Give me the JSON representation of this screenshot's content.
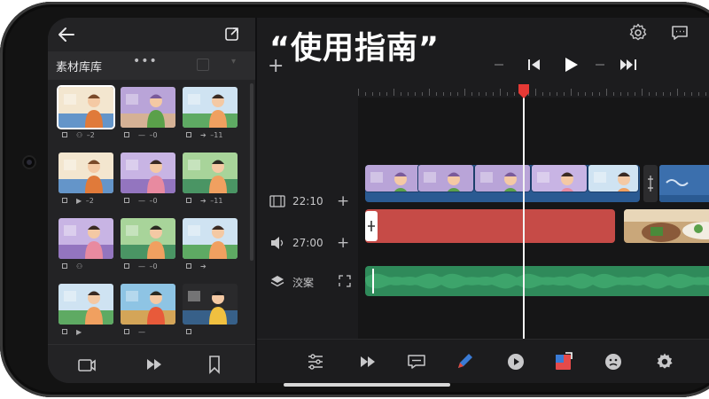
{
  "app": {
    "title": "“使用指南”"
  },
  "library": {
    "title": "素材库库",
    "more": "•••",
    "clips": [
      {
        "meta_icon": "person-icon",
        "meta": "2",
        "selected": true,
        "scene": "person-table"
      },
      {
        "meta_icon": "minus-icon",
        "meta": "0",
        "selected": false,
        "scene": "scenery"
      },
      {
        "meta_icon": "arrow-icon",
        "meta": "11",
        "selected": false,
        "scene": "person"
      },
      {
        "meta_icon": "play-icon",
        "meta": "2",
        "selected": false,
        "scene": "person-table"
      },
      {
        "meta_icon": "minus-icon",
        "meta": "0",
        "selected": false,
        "scene": "person-purple"
      },
      {
        "meta_icon": "arrow-icon",
        "meta": "11",
        "selected": false,
        "scene": "person-green"
      },
      {
        "meta_icon": "person-icon",
        "meta": "",
        "selected": false,
        "scene": "person-purple"
      },
      {
        "meta_icon": "minus-icon",
        "meta": "0",
        "selected": false,
        "scene": "person-green"
      },
      {
        "meta_icon": "arrow-icon",
        "meta": "",
        "selected": false,
        "scene": "person"
      },
      {
        "meta_icon": "play-icon",
        "meta": "",
        "selected": false,
        "scene": "person"
      },
      {
        "meta_icon": "minus-icon",
        "meta": "",
        "selected": false,
        "scene": "person-blue"
      },
      {
        "meta_icon": "",
        "meta": "",
        "selected": false,
        "scene": "person-dark"
      }
    ]
  },
  "tracks": {
    "video_time": "22:10",
    "audio_time": "27:00",
    "background_label": "洨案"
  },
  "colors": {
    "background": "#1c1c1e",
    "panel": "#232325",
    "video_track": "#2a5a92",
    "audio_track": "#c64b47",
    "bg_track": "#2f8a5a",
    "playhead": "#e53935"
  }
}
